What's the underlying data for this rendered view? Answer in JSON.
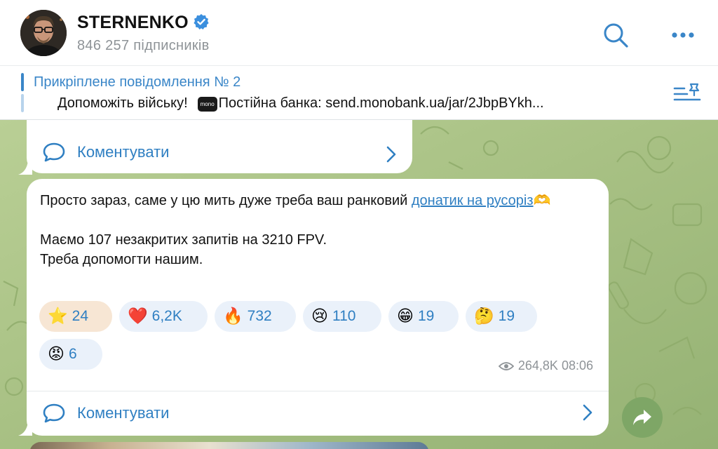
{
  "header": {
    "channel_name": "STERNENKO",
    "subscribers": "846 257 підписників",
    "search_icon": "search-icon",
    "more_icon": "more-dots-icon"
  },
  "pinned": {
    "title": "Прикріплене повідомлення № 2",
    "text_before": "Допоможіть війську!",
    "badge": "mono",
    "text_after": "Постійна банка: send.monobank.ua/jar/2JbpBYkh..."
  },
  "chat": {
    "previous_comment_label": "Коментувати",
    "message": {
      "line1_text": "Просто зараз, саме у цю мить дуже треба ваш ранковий",
      "link_text": "донатик на русоріз",
      "emoji_after_link": "🫶",
      "line3": "Маємо 107 незакритих запитів на 3210 FPV.",
      "line4": "Треба допомогти нашим."
    },
    "reactions": [
      {
        "emoji": "⭐",
        "count": "24",
        "active": true
      },
      {
        "emoji": "❤️",
        "count": "6,2K",
        "active": false
      },
      {
        "emoji": "🔥",
        "count": "732",
        "active": false
      },
      {
        "emoji": "😢",
        "count": "110",
        "active": false
      },
      {
        "emoji": "😁",
        "count": "19",
        "active": false
      },
      {
        "emoji": "🤔",
        "count": "19",
        "active": false
      },
      {
        "emoji": "😡",
        "count": "6",
        "active": false
      }
    ],
    "views": "264,8K",
    "time": "08:06",
    "comment_label": "Коментувати"
  },
  "colors": {
    "accent": "#2f7fc2",
    "reaction_bg": "#eaf1fa",
    "reaction_active_bg": "#f7e6d4",
    "wallpaper": "#a9c288",
    "share_button": "#7ea666"
  }
}
